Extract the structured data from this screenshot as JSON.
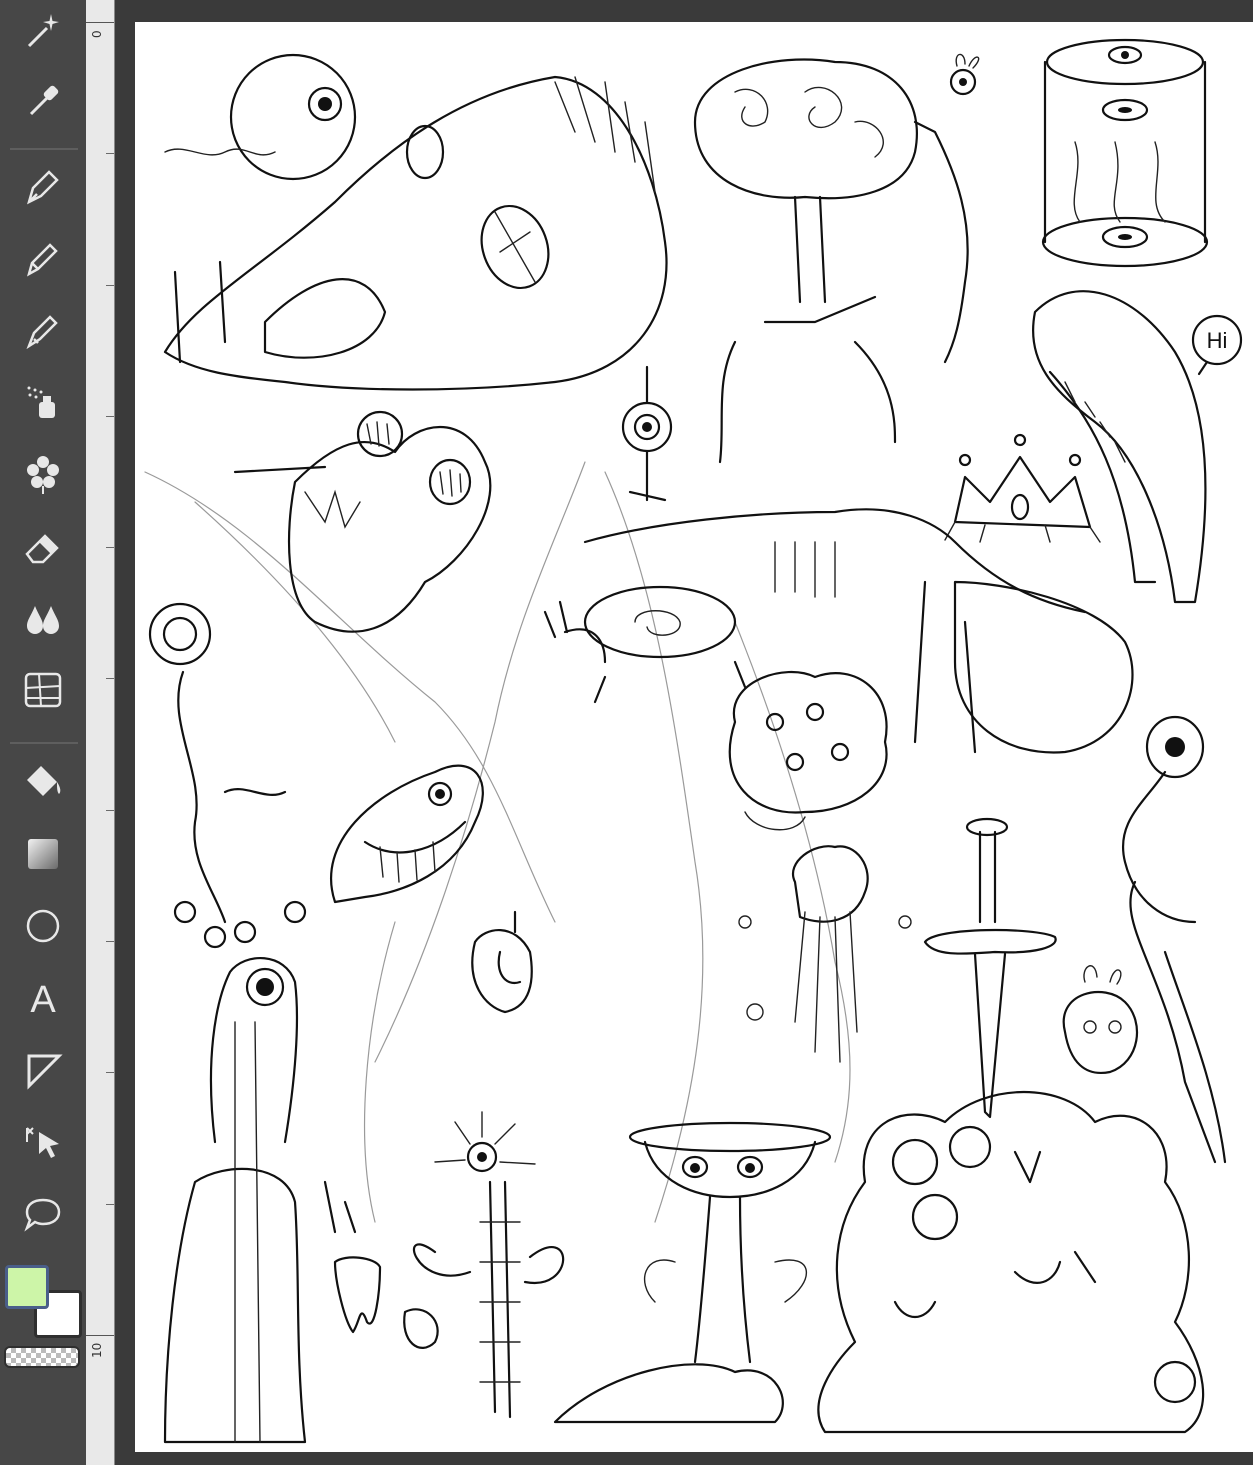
{
  "toolbar": {
    "tools": [
      {
        "name": "magic-wand-tool",
        "icon": "magic-wand-icon"
      },
      {
        "name": "eyedropper-tool",
        "icon": "eyedropper-icon"
      },
      {
        "name": "pen-tool",
        "icon": "pen-icon"
      },
      {
        "name": "pencil-tool",
        "icon": "pencil-icon"
      },
      {
        "name": "brush-tool",
        "icon": "brush-icon"
      },
      {
        "name": "airbrush-tool",
        "icon": "airbrush-icon"
      },
      {
        "name": "decoration-tool",
        "icon": "flower-icon"
      },
      {
        "name": "eraser-tool",
        "icon": "eraser-icon"
      },
      {
        "name": "blend-tool",
        "icon": "droplets-icon"
      },
      {
        "name": "frame-border-tool",
        "icon": "grid-icon"
      },
      {
        "name": "fill-tool",
        "icon": "paint-bucket-icon"
      },
      {
        "name": "gradient-tool",
        "icon": "gradient-icon"
      },
      {
        "name": "figure-tool",
        "icon": "circle-icon"
      },
      {
        "name": "text-tool",
        "icon": "text-icon"
      },
      {
        "name": "ruler-tool",
        "icon": "ruler-triangle-icon"
      },
      {
        "name": "operation-tool",
        "icon": "cursor-icon"
      },
      {
        "name": "lasso-tool",
        "icon": "speech-balloon-icon"
      }
    ],
    "text_tool_glyph": "A"
  },
  "colors": {
    "main_color": "#cdf5a8",
    "sub_color": "#ffffff",
    "toolbar_bg": "#474747",
    "canvas_bg": "#ffffff"
  },
  "ruler": {
    "labels": [
      "0",
      "10"
    ]
  },
  "canvas": {
    "speech_text": "Hi"
  }
}
